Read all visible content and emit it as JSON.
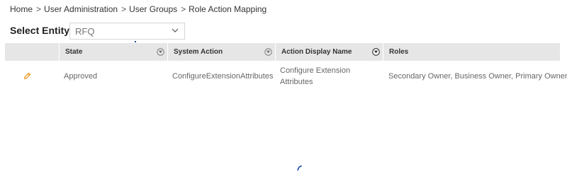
{
  "breadcrumb": {
    "items": [
      "Home",
      "User Administration",
      "User Groups",
      "Role Action Mapping"
    ],
    "separator": ">"
  },
  "entity": {
    "label": "Select Entity",
    "selected": "RFQ"
  },
  "grid": {
    "columns": [
      {
        "label": "State",
        "filter_icon": "filter-icon"
      },
      {
        "label": "System Action",
        "filter_icon": "filter-icon"
      },
      {
        "label": "Action Display Name",
        "filter_icon": "filter-icon-active"
      },
      {
        "label": "Roles"
      }
    ],
    "rows": [
      {
        "edit_icon": "pencil-icon",
        "state": "Approved",
        "system_action": "ConfigureExtensionAttributes",
        "action_display_name_line1": "Configure Extension",
        "action_display_name_line2": "Attributes",
        "roles": "Secondary Owner, Business Owner, Primary Owner"
      }
    ]
  },
  "colors": {
    "header_bg": "#e6e6e6",
    "edit_icon": "#f0a030",
    "text": "#666666",
    "accent": "#1a4aa8"
  }
}
